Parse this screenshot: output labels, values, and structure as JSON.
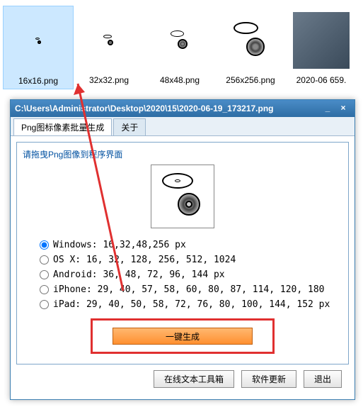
{
  "files": [
    {
      "name": "16x16.png",
      "iconSize": 10,
      "selected": true
    },
    {
      "name": "32x32.png",
      "iconSize": 18
    },
    {
      "name": "48x48.png",
      "iconSize": 30
    },
    {
      "name": "256x256.png",
      "iconSize": 56
    },
    {
      "name": "2020-06 659.",
      "iconSize": 0,
      "partial": true
    }
  ],
  "dialog": {
    "title": "C:\\Users\\Administrator\\Desktop\\2020\\15\\2020-06-19_173217.png",
    "tabs": {
      "active": "Png图标像素批量生成",
      "inactive": "关于"
    },
    "groupTitle": "请拖曳Png图像到程序界面",
    "options": [
      {
        "label": "Windows: 16,32,48,256 px",
        "checked": true
      },
      {
        "label": "OS X: 16, 32, 128, 256, 512, 1024"
      },
      {
        "label": "Android: 36, 48, 72, 96, 144 px"
      },
      {
        "label": "iPhone: 29, 40, 57, 58, 60, 80, 87, 114, 120, 180"
      },
      {
        "label": "iPad: 29, 40, 50, 58, 72, 76, 80, 100, 144, 152 px"
      }
    ],
    "generateBtn": "一键生成",
    "footer": {
      "toolbox": "在线文本工具箱",
      "update": "软件更新",
      "exit": "退出"
    }
  }
}
